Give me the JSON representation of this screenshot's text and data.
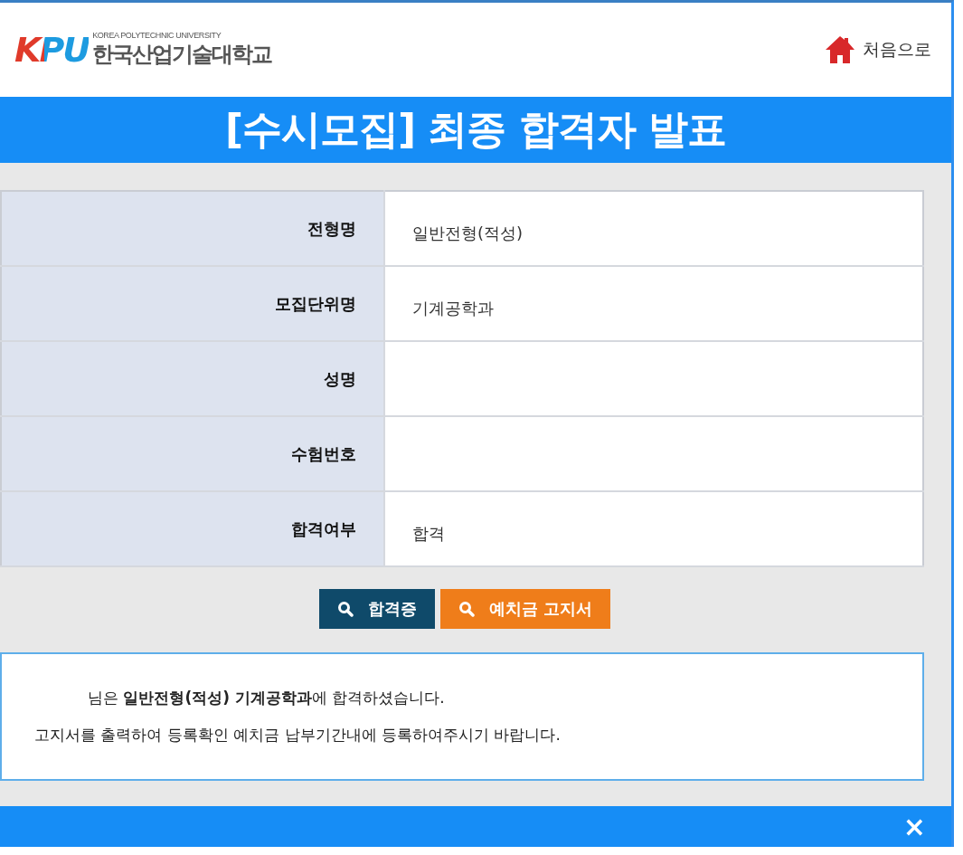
{
  "header": {
    "logo_mark": "KPU",
    "logo_subtitle": "KOREA POLYTECHNIC UNIVERSITY",
    "logo_name": "한국산업기술대학교",
    "home_link": "처음으로"
  },
  "title": "[수시모집] 최종 합격자 발표",
  "table": {
    "rows": [
      {
        "label": "전형명",
        "value": "일반전형(적성)"
      },
      {
        "label": "모집단위명",
        "value": "기계공학과"
      },
      {
        "label": "성명"
      },
      {
        "label": "수험번호"
      },
      {
        "label": "합격여부",
        "value": "합격"
      }
    ]
  },
  "buttons": [
    {
      "label": "합격증",
      "kind": "certificate"
    },
    {
      "label": "예치금 고지서",
      "kind": "notice"
    }
  ],
  "message": [
    "님은 **일반전형(적성) 기계공학과**에 합격하셨습니다.",
    "고지서를 출력하여 등록확인 예치금 납부기간내에 등록하여주시기 바랍니다."
  ],
  "footer": {
    "close": "×"
  }
}
